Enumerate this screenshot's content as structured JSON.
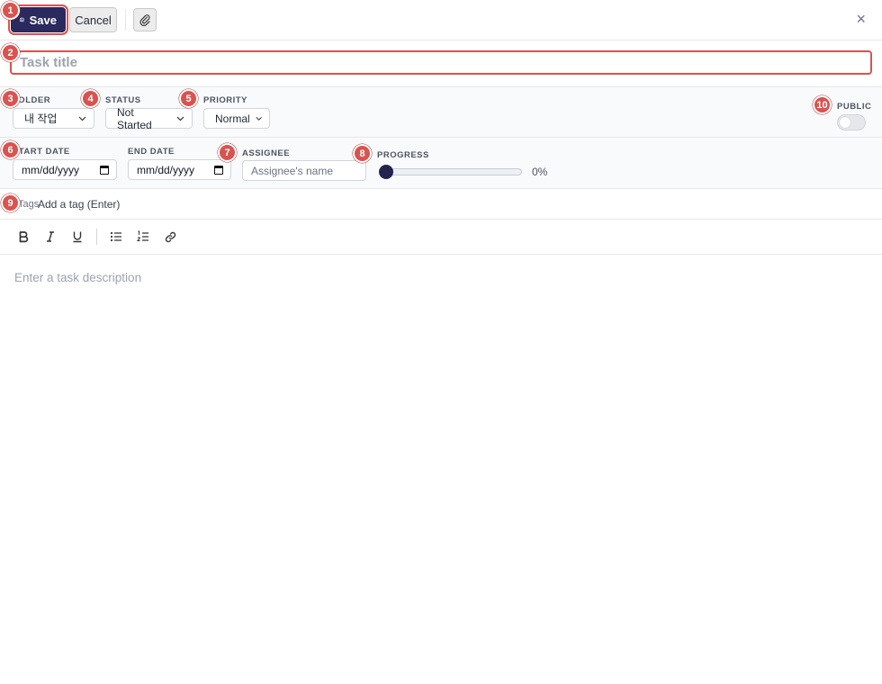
{
  "toolbar": {
    "save_label": "Save",
    "cancel_label": "Cancel",
    "close_glyph": "×"
  },
  "title": {
    "placeholder": "Task title"
  },
  "fields": {
    "folder": {
      "label": "FOLDER",
      "value": "내 작업"
    },
    "status": {
      "label": "STATUS",
      "value": "Not Started"
    },
    "priority": {
      "label": "PRIORITY",
      "value": "Normal"
    },
    "public": {
      "label": "PUBLIC",
      "on": false
    },
    "start_date": {
      "label": "START DATE",
      "value": "mm/dd/yyyy"
    },
    "end_date": {
      "label": "END DATE",
      "value": "mm/dd/yyyy"
    },
    "assignee": {
      "label": "ASSIGNEE",
      "placeholder": "Assignee's name"
    },
    "progress": {
      "label": "PROGRESS",
      "value": 0,
      "display": "0%"
    }
  },
  "tags": {
    "label": "Tags",
    "placeholder": "Add a tag (Enter)"
  },
  "editor": {
    "placeholder": "Enter a task description"
  },
  "badges": [
    "1",
    "2",
    "3",
    "4",
    "5",
    "6",
    "7",
    "8",
    "9",
    "10"
  ],
  "colors": {
    "accent": "#2a2a5e",
    "badge": "#d9534f"
  },
  "icons": [
    "save-icon",
    "paperclip-icon",
    "close-icon",
    "bold-icon",
    "italic-icon",
    "underline-icon",
    "bullet-list-icon",
    "numbered-list-icon",
    "link-icon",
    "calendar-icon",
    "chevron-down-icon"
  ]
}
